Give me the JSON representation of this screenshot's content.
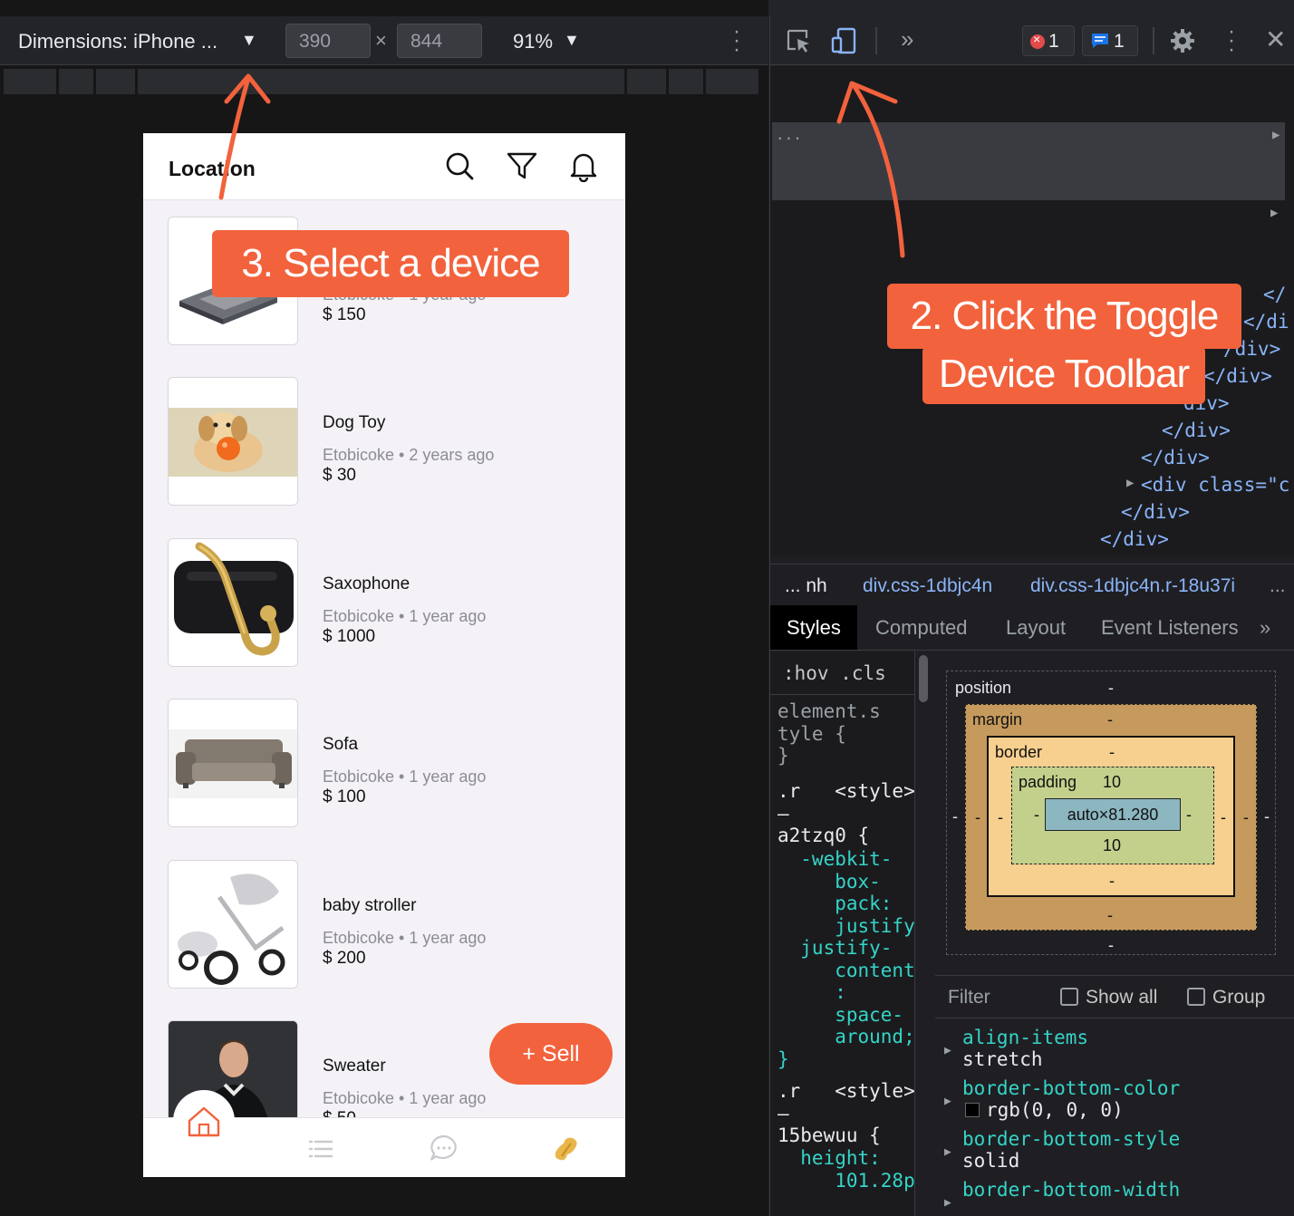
{
  "device_toolbar": {
    "dimensions_label": "Dimensions: iPhone ...",
    "width_value": "390",
    "height_value": "844",
    "times_sign": "×",
    "zoom_label": "91%"
  },
  "phone": {
    "header_title": "Location",
    "listings": [
      {
        "name": "",
        "meta": "Etobicoke • 1 year ago",
        "price": "$ 150",
        "image": "laptop"
      },
      {
        "name": "Dog Toy",
        "meta": "Etobicoke • 2 years ago",
        "price": "$ 30",
        "image": "puppy-with-ball"
      },
      {
        "name": "Saxophone",
        "meta": "Etobicoke • 1 year ago",
        "price": "$ 1000",
        "image": "saxophone"
      },
      {
        "name": "Sofa",
        "meta": "Etobicoke • 1 year ago",
        "price": "$ 100",
        "image": "sofa"
      },
      {
        "name": "baby stroller",
        "meta": "Etobicoke • 1 year ago",
        "price": "$ 200",
        "image": "stroller"
      },
      {
        "name": "Sweater",
        "meta": "Etobicoke • 1 year ago",
        "price": "$ 50",
        "image": "man-in-sweater"
      }
    ],
    "sell_button": "+ Sell",
    "tabs": [
      "home-icon",
      "list-icon",
      "chat-icon",
      "profile-icon"
    ],
    "accent_color": "#f2623c"
  },
  "annotations": {
    "step3": "3. Select a device",
    "step2_line1": "2. Click the Toggle",
    "step2_line2": "Device Toolbar"
  },
  "devtools": {
    "toolbar": {
      "error_count": "1",
      "message_count": "1",
      "icons": [
        "inspect-element-icon",
        "device-toggle-icon",
        "more-panels-icon",
        "settings-icon",
        "kebab-icon",
        "close-icon"
      ]
    },
    "elements": {
      "ellipsis": "...",
      "lines": [
        "</",
        "</di",
        "/div>",
        "</div>",
        "div>",
        "</div>",
        "</div>",
        "<div class=\"c",
        "</div>",
        "</div>"
      ]
    },
    "breadcrumbs": [
      "... nh",
      "div.css-1dbjc4n",
      "div.css-1dbjc4n.r-18u37i",
      "..."
    ],
    "subtabs": [
      "Styles",
      "Computed",
      "Layout",
      "Event Listeners",
      "»"
    ],
    "styles": {
      "filter": ":hov  .cls",
      "rules": [
        "element.s\ntyle {\n}",
        ".r   <style>\n–\na2tzq0 {\n",
        "  -webkit-\n     box-\n     pack:\n     justify\n  justify-\n     content\n     :\n     space-\n     around;\n}",
        ".r   <style>\n–\n15bewuu {\n",
        "  height:\n     101.28p"
      ]
    },
    "box_model": {
      "position": "position",
      "position_value": "-",
      "margin": "margin",
      "margin_value": "-",
      "border": "border",
      "border_value": "-",
      "padding": "padding",
      "padding_top": "10",
      "padding_bottom": "10",
      "content": "auto×81.280",
      "dash": "-"
    },
    "computed": {
      "filter_placeholder": "Filter",
      "show_all": "Show all",
      "group": "Group",
      "properties": [
        {
          "name": "align-items",
          "value": "stretch"
        },
        {
          "name": "border-bottom-color",
          "value": "rgb(0, 0, 0)"
        },
        {
          "name": "border-bottom-style",
          "value": "solid"
        },
        {
          "name": "border-bottom-width",
          "value": ""
        }
      ]
    }
  }
}
